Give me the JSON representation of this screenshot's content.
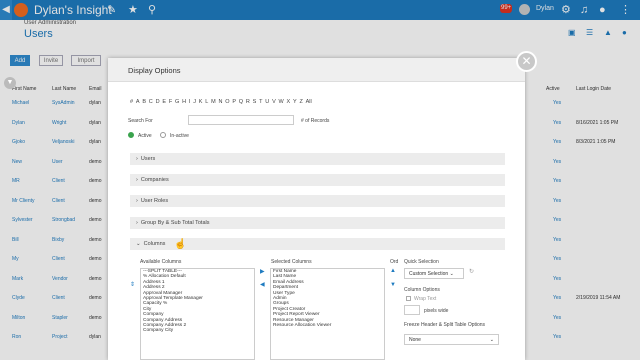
{
  "app": {
    "title": "Dylan's Insight",
    "user_name": "Dylan",
    "notification_count": "99+"
  },
  "breadcrumb": "User Administration",
  "page_title": "Users",
  "toolbar": {
    "add": "Add",
    "invite": "Invite",
    "import": "Import"
  },
  "table": {
    "headers": [
      "First Name",
      "Last Name",
      "Email",
      "Active",
      "Last Login Date"
    ],
    "rows": [
      {
        "first": "Michael",
        "last": "SysAdmin",
        "email": "dylan",
        "active": "Yes",
        "login": ""
      },
      {
        "first": "Dylan",
        "last": "Wright",
        "email": "dylan",
        "active": "Yes",
        "login": "8/16/2021 1:05 PM"
      },
      {
        "first": "Gjoko",
        "last": "Veljanoski",
        "email": "dylan",
        "active": "Yes",
        "login": "8/3/2021 1:05 PM"
      },
      {
        "first": "New",
        "last": "User",
        "email": "demo",
        "active": "Yes",
        "login": ""
      },
      {
        "first": "MR",
        "last": "Client",
        "email": "demo",
        "active": "Yes",
        "login": ""
      },
      {
        "first": "Mr Clienty",
        "last": "Client",
        "email": "demo",
        "active": "Yes",
        "login": ""
      },
      {
        "first": "Sylvester",
        "last": "Strongbad",
        "email": "demo",
        "active": "Yes",
        "login": ""
      },
      {
        "first": "Bill",
        "last": "Bixby",
        "email": "demo",
        "active": "Yes",
        "login": ""
      },
      {
        "first": "My",
        "last": "Client",
        "email": "demo",
        "active": "Yes",
        "login": ""
      },
      {
        "first": "Mark",
        "last": "Vendor",
        "email": "demo",
        "active": "Yes",
        "login": ""
      },
      {
        "first": "Clyde",
        "last": "Client",
        "email": "demo",
        "active": "Yes",
        "login": "2/19/2019 11:54 AM"
      },
      {
        "first": "Milton",
        "last": "Stapler",
        "email": "demo",
        "active": "Yes",
        "login": ""
      },
      {
        "first": "Ron",
        "last": "Project",
        "email": "dylan",
        "active": "Yes",
        "login": ""
      }
    ]
  },
  "modal": {
    "title": "Display Options",
    "alphabet": [
      "#",
      "A",
      "B",
      "C",
      "D",
      "E",
      "F",
      "G",
      "H",
      "I",
      "J",
      "K",
      "L",
      "M",
      "N",
      "O",
      "P",
      "Q",
      "R",
      "S",
      "T",
      "U",
      "V",
      "W",
      "X",
      "Y",
      "Z",
      "All"
    ],
    "search_label": "Search For",
    "records_label": "# of Records",
    "active_label": "Active",
    "inactive_label": "In-active",
    "sections": [
      "Users",
      "Companies",
      "User Roles",
      "Group By & Sub Total Totals",
      "Columns"
    ],
    "available_label": "Available Columns",
    "selected_label": "Selected Columns",
    "ord_label": "Ord",
    "available_columns": [
      "---SPLIT TABLE---",
      "% Allocation Default",
      "Address 1",
      "Address 2",
      "Approval Manager",
      "Approval Template Manager",
      "Capacity %",
      "City",
      "Company",
      "Company Address",
      "Company Address 2",
      "Company City"
    ],
    "selected_columns": [
      "First Name",
      "Last Name",
      "Email Address",
      "Department",
      "User Type",
      "Admin",
      "Groups",
      "Project Creator",
      "Project Report Viewer",
      "Resource Manager",
      "Resource Allocation Viewer"
    ],
    "quick_selection_label": "Quick Selection",
    "quick_selection_value": "Custom Selection",
    "column_options_label": "Column Options",
    "wrap_text_label": "Wrap Text",
    "pixels_wide_label": "pixels wide",
    "freeze_label": "Freeze Header & Split Table Options",
    "freeze_value": "None"
  }
}
